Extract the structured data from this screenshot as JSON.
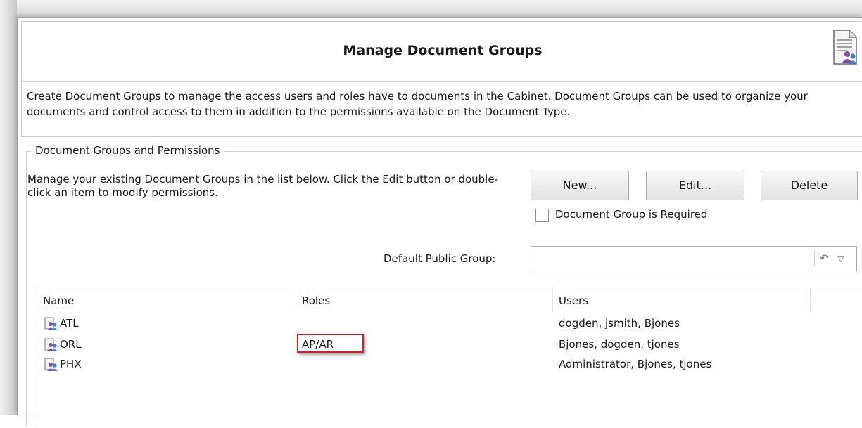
{
  "header": {
    "title": "Manage Document Groups",
    "icon": "document-users-icon"
  },
  "description": "Create Document Groups to manage the access users and roles have to documents in the Cabinet.  Document Groups can be used to organize your documents and control access to them in addition to the permissions available on the Document Type.",
  "group": {
    "legend": "Document Groups and Permissions",
    "manage_text": "Manage your existing Document Groups in the list below.  Click the Edit button or double-click an item to modify permissions.",
    "buttons": {
      "new": "New...",
      "edit": "Edit...",
      "delete": "Delete"
    },
    "required_checkbox": {
      "label": "Document Group is Required",
      "checked": false
    },
    "default_public_group": {
      "label": "Default Public Group:",
      "value": ""
    }
  },
  "list": {
    "columns": [
      "Name",
      "Roles",
      "Users"
    ],
    "rows": [
      {
        "name": "ATL",
        "roles": "",
        "users": "dogden, jsmith, Bjones"
      },
      {
        "name": "ORL",
        "roles": "AP/AR",
        "users": "Bjones, dogden, tjones"
      },
      {
        "name": "PHX",
        "roles": "",
        "users": "Administrator, Bjones, tjones"
      }
    ]
  },
  "colors": {
    "highlight": "#c1272d",
    "group_icon_primary": "#7b4fa8",
    "group_icon_secondary": "#3c7fc4"
  }
}
